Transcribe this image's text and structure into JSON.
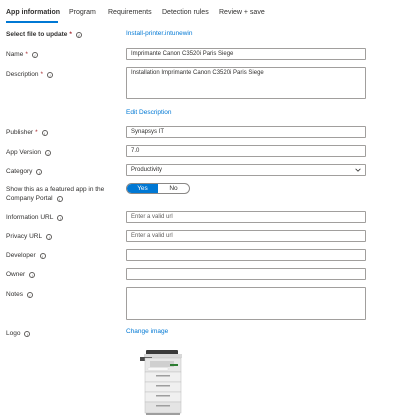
{
  "tabs": [
    {
      "label": "App information"
    },
    {
      "label": "Program"
    },
    {
      "label": "Requirements"
    },
    {
      "label": "Detection rules"
    },
    {
      "label": "Review + save"
    }
  ],
  "form": {
    "select_file": {
      "label": "Select file to update",
      "required": "*",
      "link": "Install-printer.intunewin"
    },
    "name": {
      "label": "Name",
      "required": "*",
      "value": "Imprimante Canon C3520i Paris Siege"
    },
    "description": {
      "label": "Description",
      "required": "*",
      "value": "Installation Imprimante Canon C3520i Paris Siege",
      "edit_link": "Edit Description"
    },
    "publisher": {
      "label": "Publisher",
      "required": "*",
      "value": "Synapsys IT"
    },
    "app_version": {
      "label": "App Version",
      "value": "7.0"
    },
    "category": {
      "label": "Category",
      "value": "Productivity"
    },
    "featured": {
      "label_line1": "Show this as a featured app in the",
      "label_line2": "Company Portal",
      "yes": "Yes",
      "no": "No",
      "selected": "Yes"
    },
    "information_url": {
      "label": "Information URL",
      "placeholder": "Enter a valid url"
    },
    "privacy_url": {
      "label": "Privacy URL",
      "placeholder": "Enter a valid url"
    },
    "developer": {
      "label": "Developer",
      "value": ""
    },
    "owner": {
      "label": "Owner",
      "value": ""
    },
    "notes": {
      "label": "Notes",
      "value": ""
    },
    "logo": {
      "label": "Logo",
      "link": "Change image"
    }
  },
  "icons": {
    "info": "info-icon",
    "dropdown": "chevron-down-icon"
  },
  "colors": {
    "accent": "#0078d4",
    "required": "#a4262c",
    "border": "#a19f9d"
  }
}
